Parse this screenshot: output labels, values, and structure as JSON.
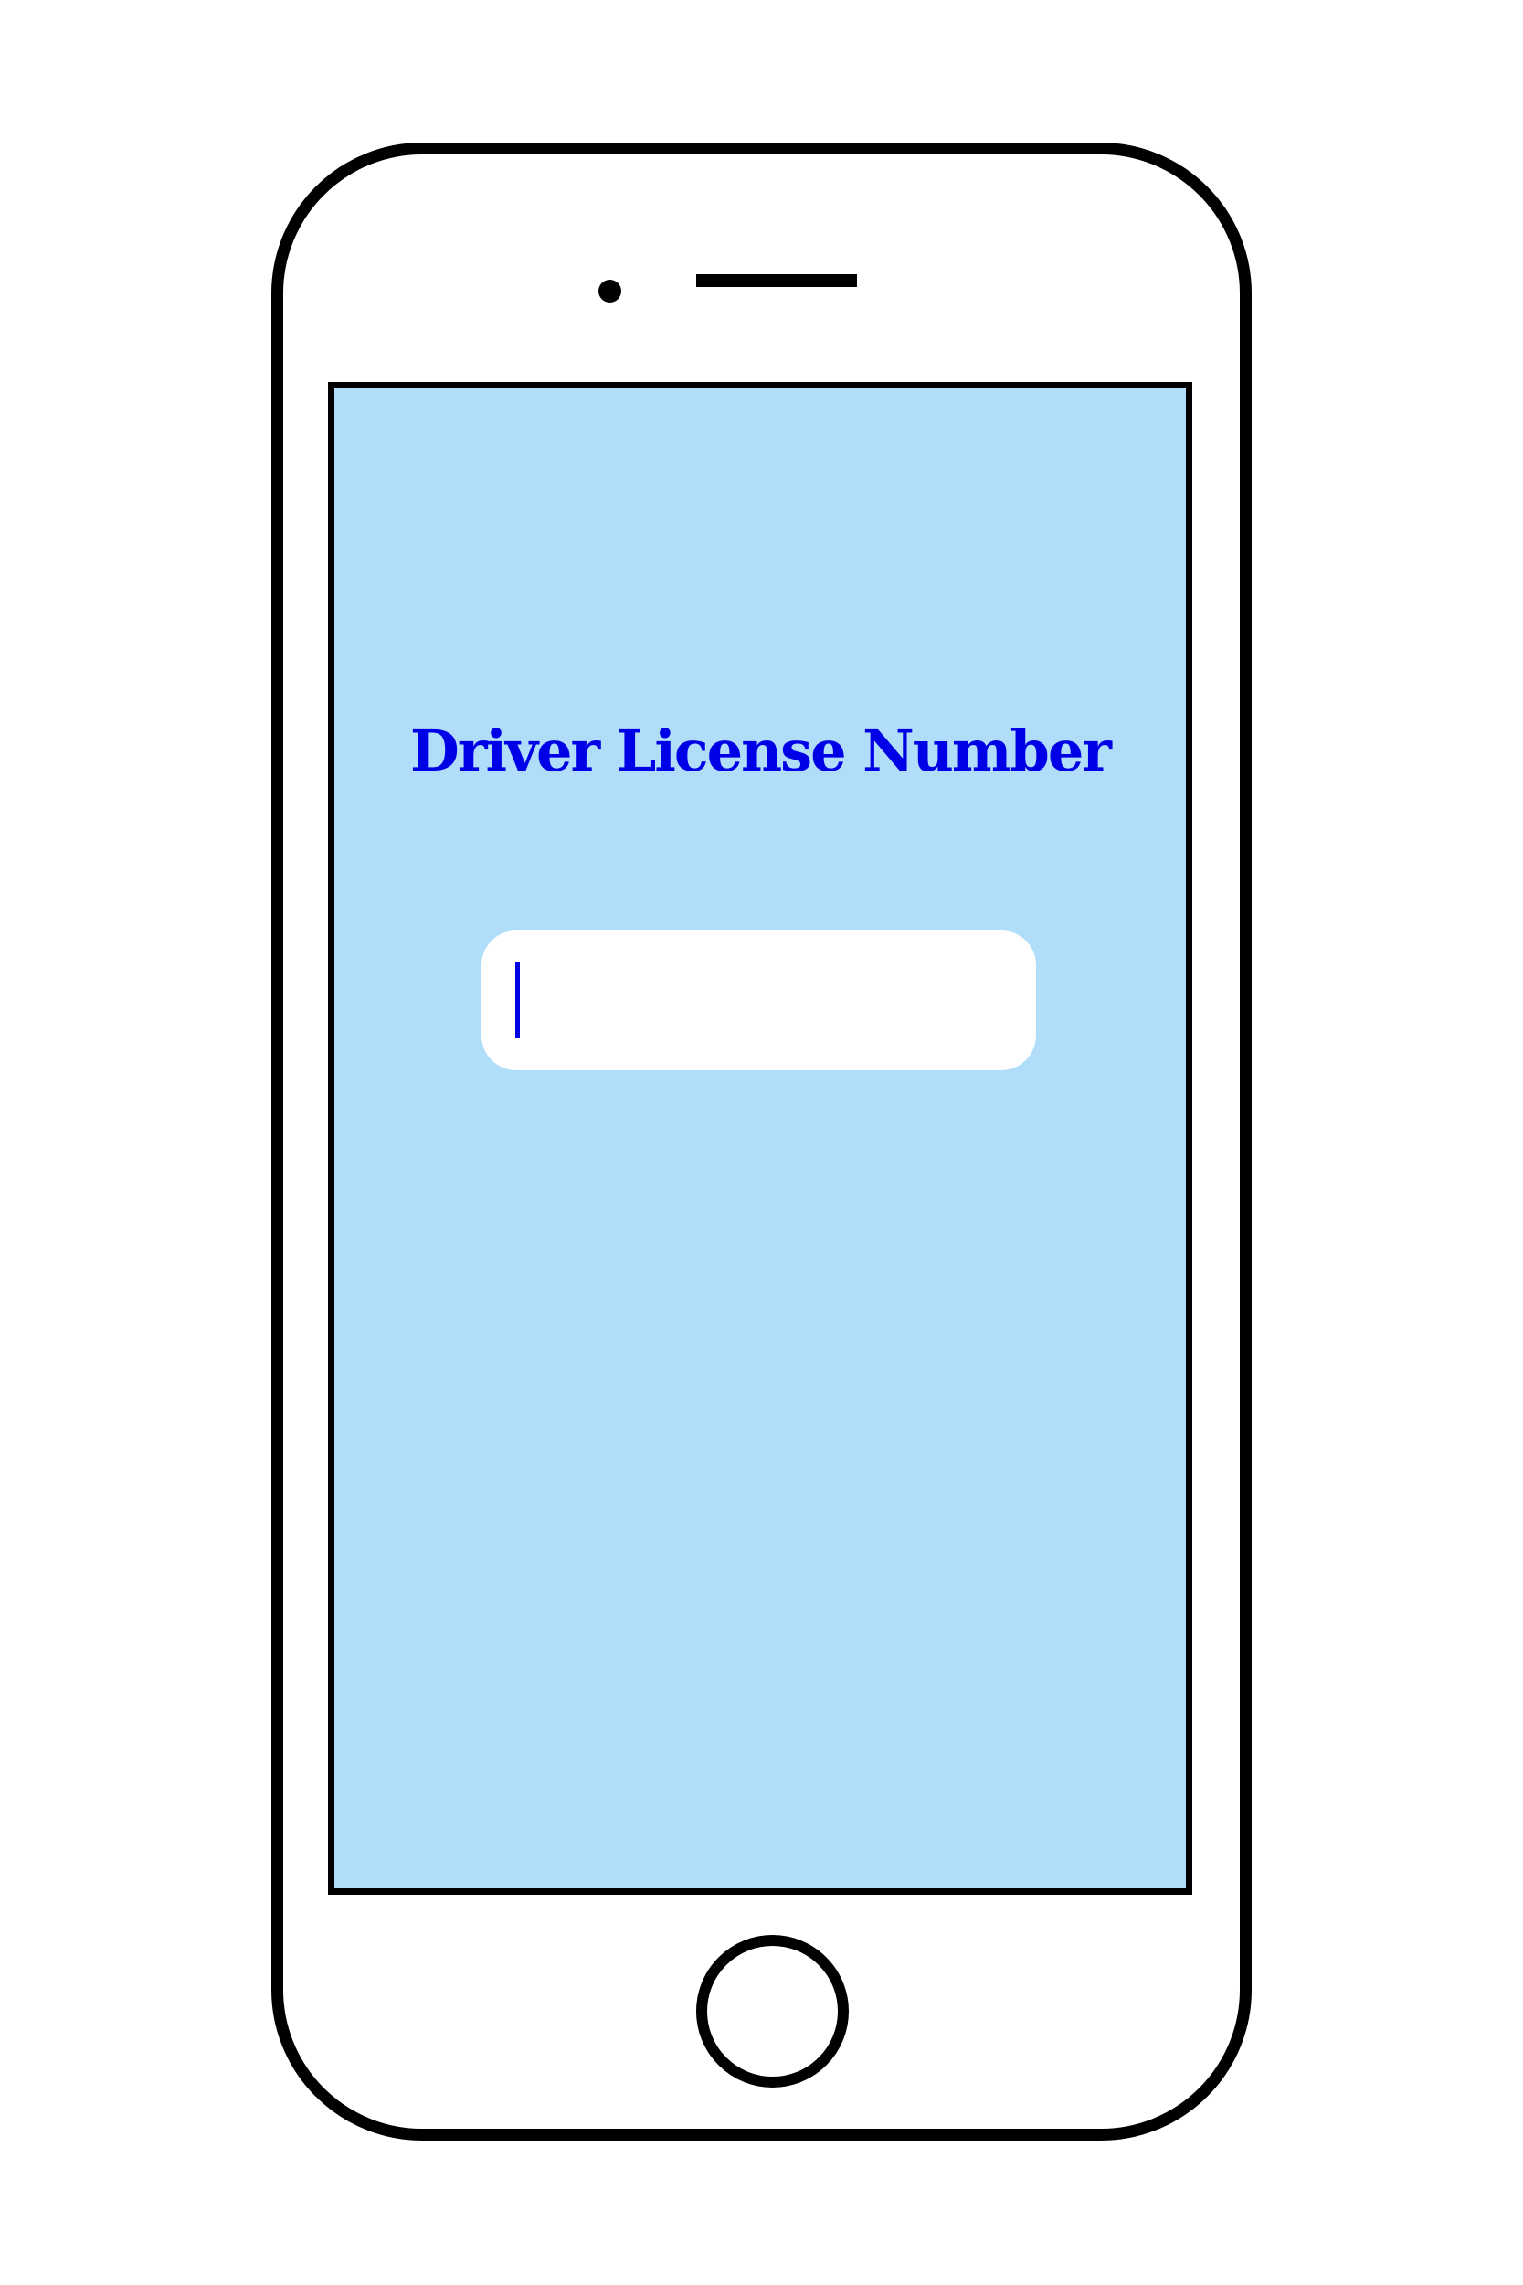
{
  "screen": {
    "title": "Driver License Number",
    "title_color": "#0000e6",
    "background_color": "#b0ddfa"
  },
  "license_input": {
    "value": "",
    "placeholder": ""
  },
  "device": {
    "frame_color": "#000000",
    "camera_icon": "camera-dot",
    "speaker_icon": "speaker-slot",
    "home_button_icon": "home-button-circle"
  }
}
